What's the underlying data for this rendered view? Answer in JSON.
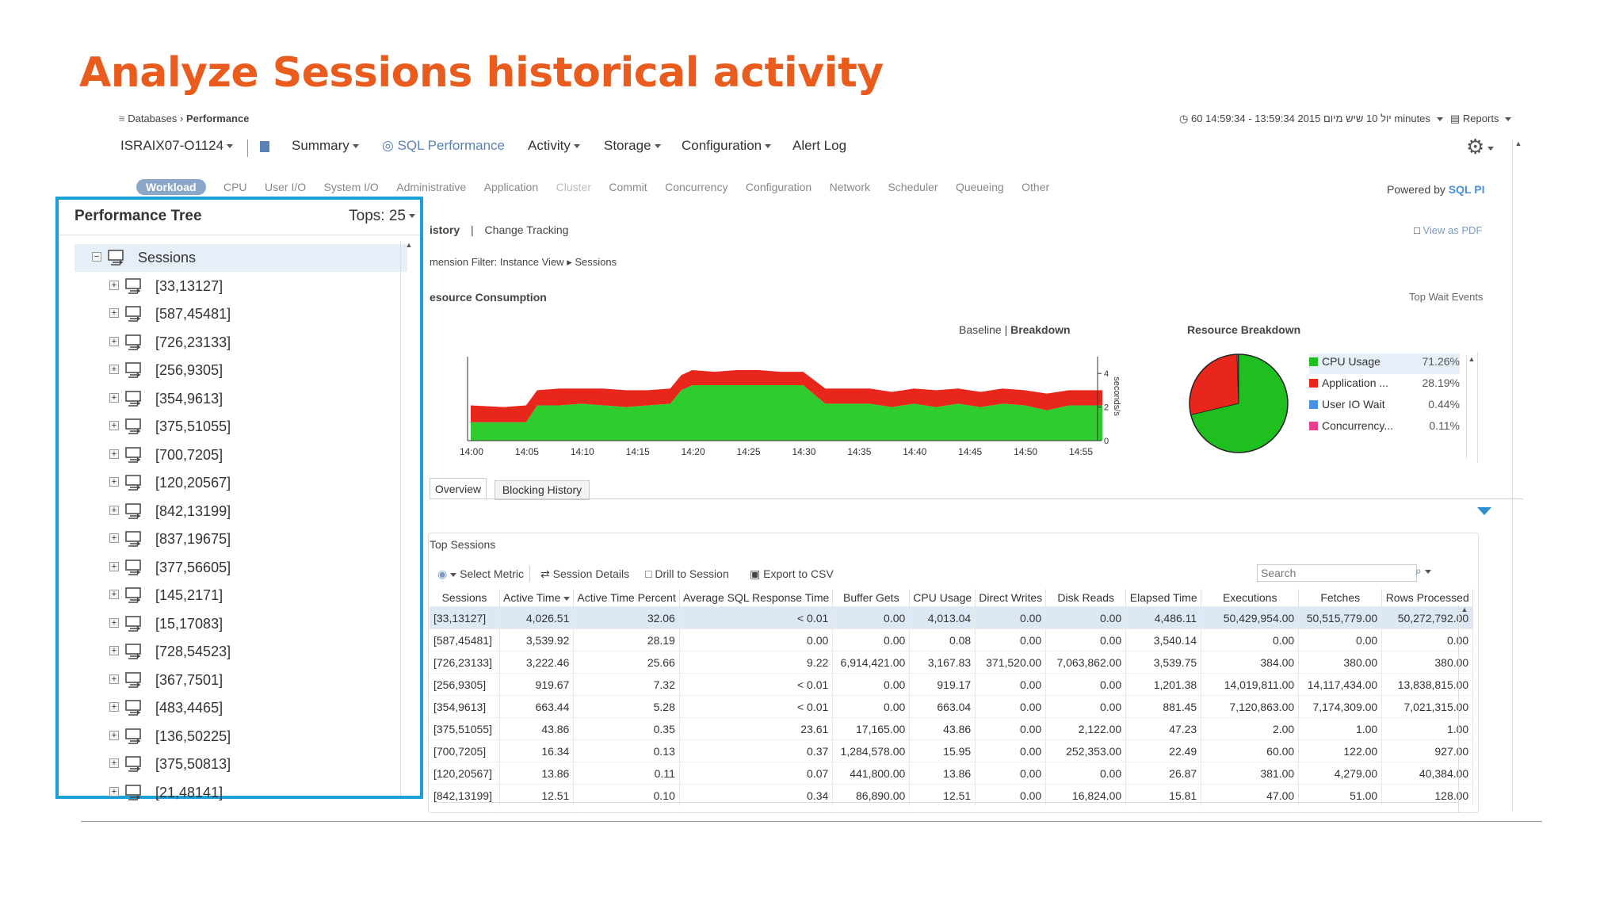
{
  "slide_title": "Analyze Sessions historical activity",
  "breadcrumb": {
    "root": "Databases",
    "current": "Performance"
  },
  "time_range": "60 14:59:34 - 13:59:34 2015 יול 10 שיש מיום minutes",
  "reports_label": "Reports",
  "instance_label": "ISRAIX07-O1124",
  "nav": {
    "summary": "Summary",
    "sql_performance": "SQL Performance",
    "activity": "Activity",
    "storage": "Storage",
    "configuration": "Configuration",
    "alert_log": "Alert Log"
  },
  "subtabs": [
    "Workload",
    "CPU",
    "User I/O",
    "System I/O",
    "Administrative",
    "Application",
    "Cluster",
    "Commit",
    "Concurrency",
    "Configuration",
    "Network",
    "Scheduler",
    "Queueing",
    "Other"
  ],
  "powered_by": "Powered by",
  "powered_brand": "SQL PI",
  "history_tabs": {
    "history": "istory",
    "separator": "|",
    "change_tracking": "Change Tracking"
  },
  "view_pdf": "View as PDF",
  "dimension_filter": {
    "prefix": "mension Filter: Instance View",
    "item": "Sessions"
  },
  "resource_consumption": "esource Consumption",
  "top_wait_events": "Top Wait Events",
  "baseline": "Baseline",
  "breakdown": "Breakdown",
  "resource_breakdown_title": "Resource Breakdown",
  "tree": {
    "title": "Performance Tree",
    "tops": "Tops: 25",
    "root": "Sessions",
    "items": [
      "[33,13127]",
      "[587,45481]",
      "[726,23133]",
      "[256,9305]",
      "[354,9613]",
      "[375,51055]",
      "[700,7205]",
      "[120,20567]",
      "[842,13199]",
      "[837,19675]",
      "[377,56605]",
      "[145,2171]",
      "[15,17083]",
      "[728,54523]",
      "[367,7501]",
      "[483,4465]",
      "[136,50225]",
      "[375,50813]",
      "[21,48141]"
    ]
  },
  "bottom_tabs": {
    "overview": "Overview",
    "blocking_history": "Blocking History"
  },
  "top_sessions": "Top Sessions",
  "toolbar": {
    "select_metric": "Select Metric",
    "session_details": "Session Details",
    "drill_to_session": "Drill to Session",
    "export_csv": "Export to CSV",
    "search_placeholder": "Search"
  },
  "table": {
    "headers": [
      "Sessions",
      "Active Time",
      "Active Time Percent",
      "Average SQL Response Time",
      "Buffer Gets",
      "CPU Usage",
      "Direct Writes",
      "Disk Reads",
      "Elapsed Time",
      "Executions",
      "Fetches",
      "Rows Processed"
    ],
    "rows": [
      [
        "[33,13127]",
        "4,026.51",
        "32.06",
        "< 0.01",
        "0.00",
        "4,013.04",
        "0.00",
        "0.00",
        "4,486.11",
        "50,429,954.00",
        "50,515,779.00",
        "50,272,792.00"
      ],
      [
        "[587,45481]",
        "3,539.92",
        "28.19",
        "0.00",
        "0.00",
        "0.08",
        "0.00",
        "0.00",
        "3,540.14",
        "0.00",
        "0.00",
        "0.00"
      ],
      [
        "[726,23133]",
        "3,222.46",
        "25.66",
        "9.22",
        "6,914,421.00",
        "3,167.83",
        "371,520.00",
        "7,063,862.00",
        "3,539.75",
        "384.00",
        "380.00",
        "380.00"
      ],
      [
        "[256,9305]",
        "919.67",
        "7.32",
        "< 0.01",
        "0.00",
        "919.17",
        "0.00",
        "0.00",
        "1,201.38",
        "14,019,811.00",
        "14,117,434.00",
        "13,838,815.00"
      ],
      [
        "[354,9613]",
        "663.44",
        "5.28",
        "< 0.01",
        "0.00",
        "663.04",
        "0.00",
        "0.00",
        "881.45",
        "7,120,863.00",
        "7,174,309.00",
        "7,021,315.00"
      ],
      [
        "[375,51055]",
        "43.86",
        "0.35",
        "23.61",
        "17,165.00",
        "43.86",
        "0.00",
        "2,122.00",
        "47.23",
        "2.00",
        "1.00",
        "1.00"
      ],
      [
        "[700,7205]",
        "16.34",
        "0.13",
        "0.37",
        "1,284,578.00",
        "15.95",
        "0.00",
        "252,353.00",
        "22.49",
        "60.00",
        "122.00",
        "927.00"
      ],
      [
        "[120,20567]",
        "13.86",
        "0.11",
        "0.07",
        "441,800.00",
        "13.86",
        "0.00",
        "0.00",
        "26.87",
        "381.00",
        "4,279.00",
        "40,384.00"
      ],
      [
        "[842,13199]",
        "12.51",
        "0.10",
        "0.34",
        "86,890.00",
        "12.51",
        "0.00",
        "16,824.00",
        "15.81",
        "47.00",
        "51.00",
        "128.00"
      ]
    ]
  },
  "chart_data": [
    {
      "type": "area",
      "title": "",
      "ylabel": "seconds/s",
      "xticks": [
        "14:00",
        "14:05",
        "14:10",
        "14:15",
        "14:20",
        "14:25",
        "14:30",
        "14:35",
        "14:40",
        "14:45",
        "14:50",
        "14:55"
      ],
      "yticks": [
        "0",
        "2",
        "4"
      ],
      "ylim": [
        0,
        5
      ],
      "x": [
        "14:00",
        "14:03",
        "14:05",
        "14:06",
        "14:08",
        "14:10",
        "14:12",
        "14:14",
        "14:16",
        "14:18",
        "14:19",
        "14:20",
        "14:22",
        "14:24",
        "14:26",
        "14:28",
        "14:30",
        "14:32",
        "14:34",
        "14:36",
        "14:38",
        "14:40",
        "14:42",
        "14:44",
        "14:46",
        "14:48",
        "14:50",
        "14:52",
        "14:54",
        "14:55",
        "14:57"
      ],
      "series": [
        {
          "color": "#2ecc2e",
          "values": [
            1.1,
            1.1,
            1.1,
            2.1,
            2.1,
            2.2,
            2.1,
            2.0,
            2.1,
            2.2,
            3.0,
            3.3,
            3.3,
            3.3,
            3.3,
            3.3,
            3.3,
            2.2,
            2.2,
            2.2,
            2.0,
            2.2,
            2.0,
            2.2,
            2.0,
            2.2,
            2.1,
            1.8,
            2.1,
            2.1,
            2.1
          ]
        },
        {
          "color": "#e8261c",
          "values": [
            1.0,
            0.9,
            1.0,
            0.9,
            1.0,
            0.9,
            1.0,
            1.0,
            0.9,
            0.9,
            0.9,
            0.9,
            0.8,
            0.9,
            0.9,
            0.8,
            0.8,
            0.9,
            0.9,
            0.9,
            0.9,
            0.9,
            1.0,
            0.9,
            0.9,
            0.9,
            0.9,
            1.0,
            0.9,
            0.9,
            0.9
          ]
        }
      ]
    },
    {
      "type": "pie",
      "title": "Resource Breakdown",
      "labels": [
        "CPU Usage",
        "Application ...",
        "User IO Wait",
        "Concurrency..."
      ],
      "values_text": [
        "71.26%",
        "28.19%",
        "0.44%",
        "0.11%"
      ],
      "values": [
        71.26,
        28.19,
        0.44,
        0.11
      ],
      "colors": [
        "#1fbf1f",
        "#e8261c",
        "#4a90e2",
        "#e83e8c"
      ]
    }
  ]
}
